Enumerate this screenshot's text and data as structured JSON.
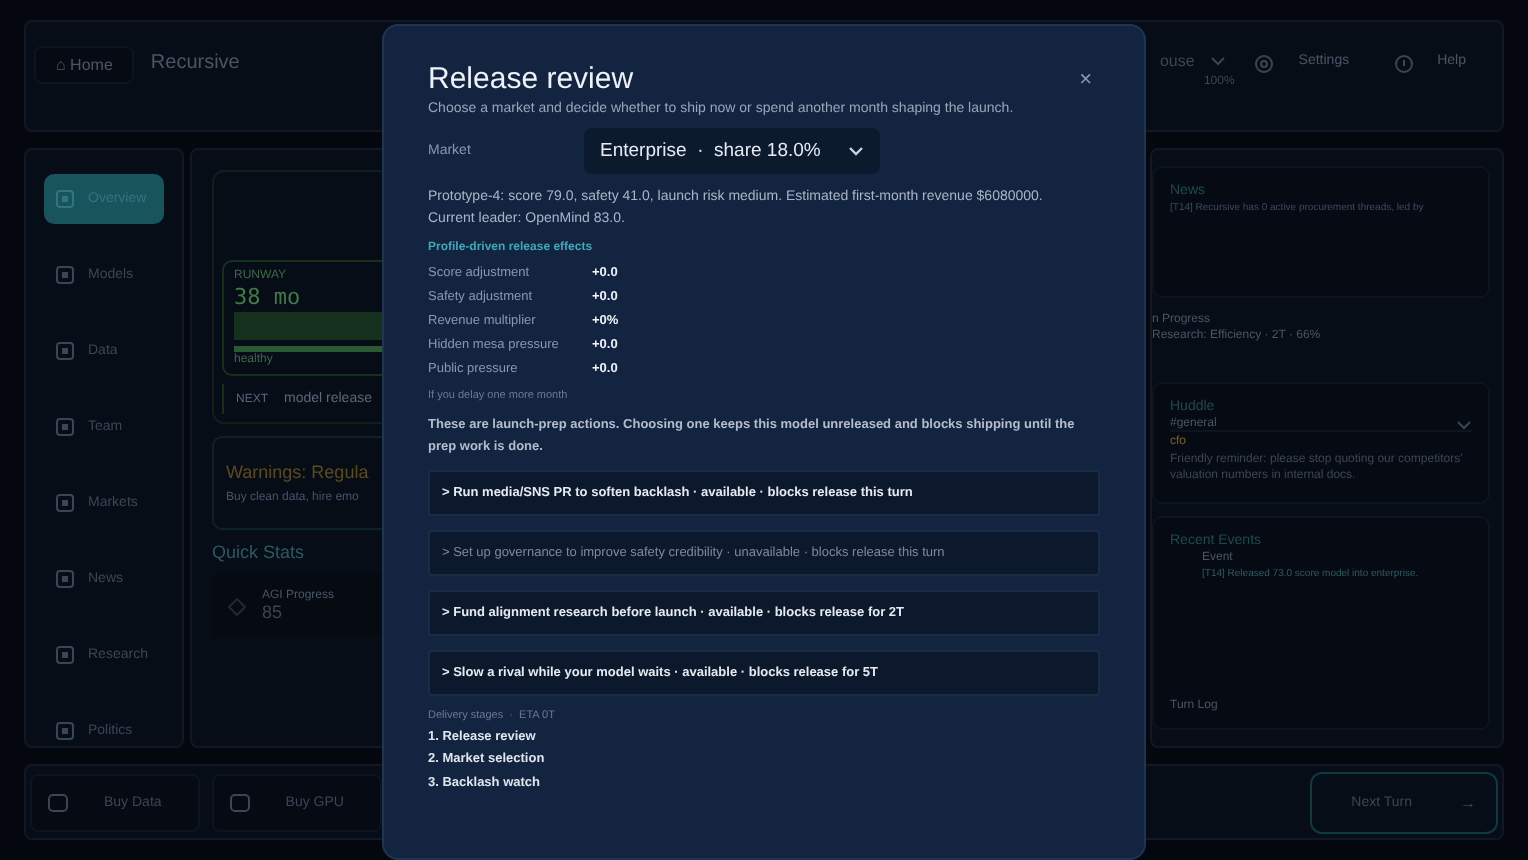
{
  "header": {
    "home_button": "⌂ Home",
    "title": "Recursive",
    "dropdown": "ouse",
    "dropdown_caption": "100%",
    "settings": "Settings",
    "help": "Help"
  },
  "sidebar": {
    "items": [
      {
        "label": "Overview",
        "selected": true
      },
      {
        "label": "Models",
        "selected": false
      },
      {
        "label": "Data",
        "selected": false
      },
      {
        "label": "Team",
        "selected": false
      },
      {
        "label": "Markets",
        "selected": false
      },
      {
        "label": "News",
        "selected": false
      },
      {
        "label": "Research",
        "selected": false
      },
      {
        "label": "Politics",
        "selected": false
      }
    ]
  },
  "dashboard": {
    "runway": {
      "label": "RUNWAY",
      "value": "38 mo",
      "status": "healthy"
    },
    "next": {
      "label": "NEXT",
      "value": "model release"
    },
    "warning": {
      "title": "Warnings: Regula",
      "text": "Buy clean data, hire emo"
    },
    "quick_stats_title": "Quick Stats",
    "stats": [
      {
        "label": "AGI Progress",
        "value": "85"
      }
    ]
  },
  "right_panel": {
    "news": {
      "title": "News",
      "text": "[T14] Recursive has 0 active procurement threads, led by"
    },
    "in_progress": {
      "title": "n Progress",
      "text": "Research: Efficiency · 2T · 66%"
    },
    "huddle": {
      "title": "Huddle",
      "channel": "#general",
      "author": "cfo",
      "message": "Friendly reminder: please stop quoting our competitors' valuation numbers in internal docs."
    },
    "events": {
      "title": "Recent Events",
      "column": "Event",
      "rows": [
        "[T14] Released 73.0 score model into enterprise."
      ],
      "footer": "Turn Log"
    }
  },
  "bottom_bar": {
    "buttons": [
      "Buy Data",
      "Buy GPU"
    ],
    "next_turn": "Next Turn",
    "next_arrow": "→"
  },
  "modal": {
    "title": "Release review",
    "subtitle": "Choose a market and decide whether to ship now or spend another month shaping the launch.",
    "close": "×",
    "market_label": "Market",
    "market_value": "Enterprise  ·  share 18.0%",
    "summary": "Prototype-4: score 79.0, safety 41.0, launch risk medium. Estimated first-month revenue $6080000.",
    "leader": "Current leader: OpenMind 83.0.",
    "effects_title": "Profile-driven release effects",
    "effects": [
      {
        "label": "Score adjustment",
        "value": "+0.0"
      },
      {
        "label": "Safety adjustment",
        "value": "+0.0"
      },
      {
        "label": "Revenue multiplier",
        "value": "+0%"
      },
      {
        "label": "Hidden mesa pressure",
        "value": "+0.0"
      },
      {
        "label": "Public pressure",
        "value": "+0.0"
      }
    ],
    "delay_title": "If you delay one more month",
    "delay_text": "These are launch-prep actions. Choosing one keeps this model unreleased and blocks shipping until the prep work is done.",
    "actions": [
      {
        "label": "> Run media/SNS PR to soften backlash · available · blocks release this turn",
        "disabled": false
      },
      {
        "label": "> Set up governance to improve safety credibility · unavailable · blocks release this turn",
        "disabled": true
      },
      {
        "label": "> Fund alignment research before launch · available · blocks release for 2T",
        "disabled": false
      },
      {
        "label": "> Slow a rival while your model waits · available · blocks release for 5T",
        "disabled": false
      }
    ],
    "stages_title": "Delivery stages  ·  ETA 0T",
    "stages": [
      "1. Release review",
      "2. Market selection",
      "3. Backlash watch"
    ]
  }
}
